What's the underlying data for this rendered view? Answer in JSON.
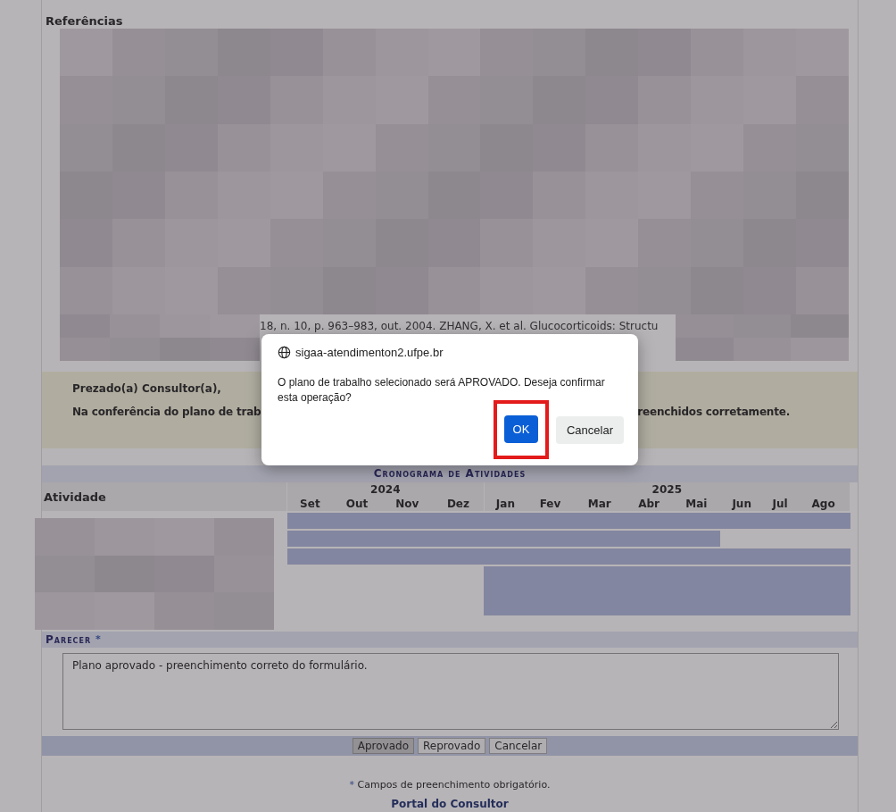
{
  "references": {
    "title": "Referências",
    "visible_fragment": "18, n. 10, p. 963–983, out. 2004. ZHANG, X. et al. Glucocorticoids: Structu"
  },
  "notice": {
    "greeting": "Prezado(a) Consultor(a),",
    "line_start": "Na conferência do plano de trab",
    "line_end": "reenchidos corretamente."
  },
  "schedule": {
    "title": "Cronograma de Atividades",
    "activity_header": "Atividade",
    "years": [
      {
        "label": "2024",
        "months": [
          "Set",
          "Out",
          "Nov",
          "Dez"
        ]
      },
      {
        "label": "2025",
        "months": [
          "Jan",
          "Fev",
          "Mar",
          "Abr",
          "Mai",
          "Jun",
          "Jul",
          "Ago"
        ]
      }
    ],
    "rows": [
      {
        "active": [
          true,
          true,
          true,
          true,
          true,
          true,
          true,
          true,
          true,
          true,
          true,
          true
        ]
      },
      {
        "active": [
          true,
          true,
          true,
          true,
          true,
          true,
          true,
          true,
          true,
          false,
          false,
          false
        ]
      },
      {
        "active": [
          true,
          true,
          true,
          true,
          true,
          true,
          true,
          true,
          true,
          true,
          true,
          true
        ]
      },
      {
        "active": [
          false,
          false,
          false,
          false,
          true,
          true,
          true,
          true,
          true,
          true,
          true,
          true
        ]
      }
    ]
  },
  "parecer": {
    "label": "Parecer",
    "required_mark": "*",
    "value": "Plano aprovado - preenchimento correto do formulário."
  },
  "buttons": [
    {
      "label": "Aprovado",
      "selected": true
    },
    {
      "label": "Reprovado",
      "selected": false
    },
    {
      "label": "Cancelar",
      "selected": false
    }
  ],
  "footer": {
    "required_mark": "*",
    "note": "Campos de preenchimento obrigatório.",
    "link": "Portal do Consultor"
  },
  "dialog": {
    "host": "sigaa-atendimenton2.ufpe.br",
    "message": "O plano de trabalho selecionado será APROVADO. Deseja confirmar esta operação?",
    "buttons": [
      {
        "label": "OK",
        "kind": "primary",
        "highlighted": true
      },
      {
        "label": "Cancelar",
        "kind": "secondary",
        "highlighted": false
      }
    ]
  }
}
